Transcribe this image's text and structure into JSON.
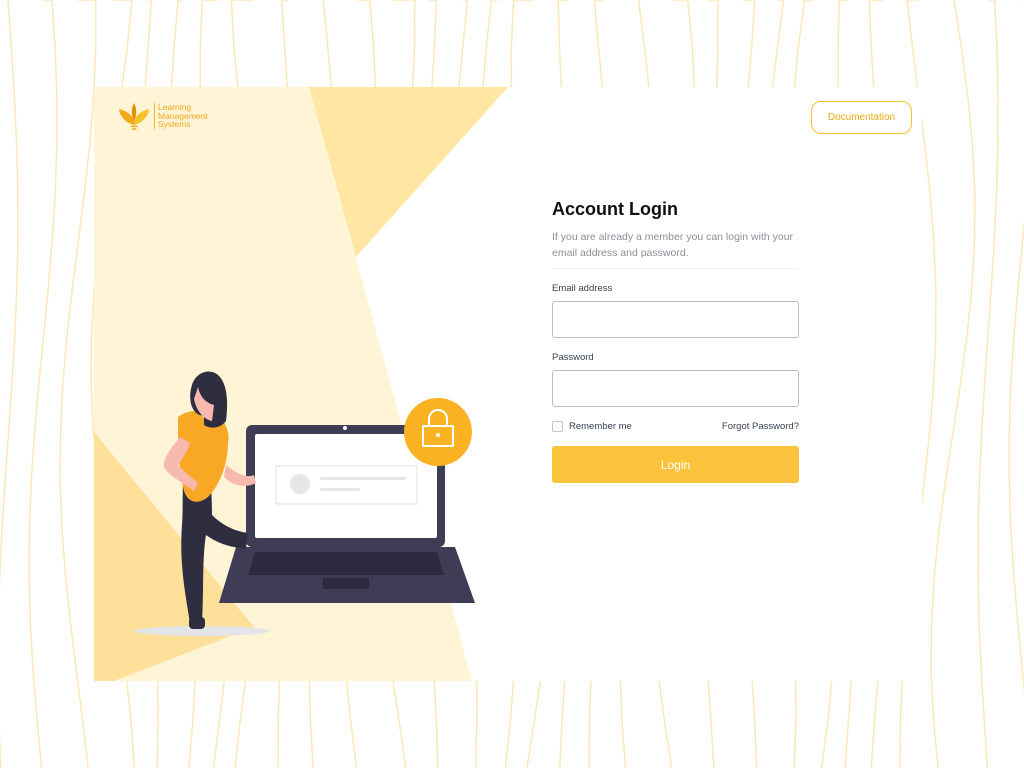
{
  "brand": {
    "name_line1": "Learning",
    "name_line2": "Management",
    "name_line3": "Systems"
  },
  "header": {
    "documentation_label": "Documentation"
  },
  "login": {
    "title": "Account Login",
    "subtitle": "If you are already a member you can login with your email address and password.",
    "email_label": "Email address",
    "email_value": "",
    "password_label": "Password",
    "password_value": "",
    "remember_label": "Remember me",
    "remember_checked": false,
    "forgot_label": "Forgot Password?",
    "submit_label": "Login"
  },
  "illustration": {
    "icons": [
      "lock-icon",
      "laptop",
      "person"
    ]
  },
  "colors": {
    "accent": "#fbc23b",
    "accent_light": "#fff3d0",
    "accent_mid": "#ffe39e",
    "laptop_dark": "#3f3d56",
    "lock_circle": "#f9b322",
    "background_lines": "#fde8b4"
  }
}
